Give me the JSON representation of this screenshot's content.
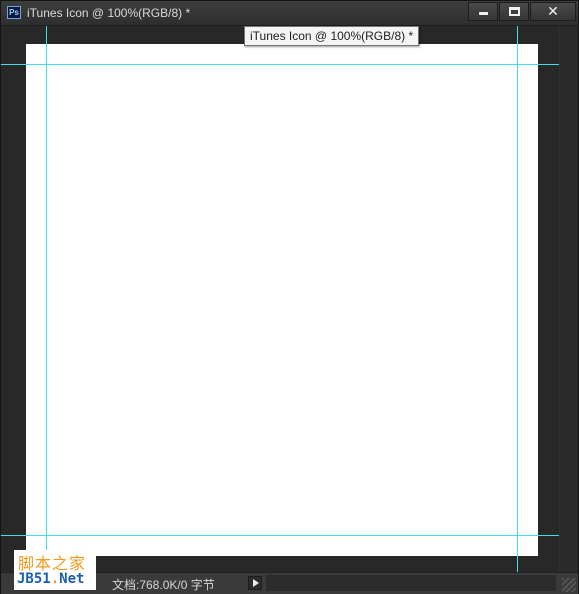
{
  "window": {
    "app_icon_label": "Ps",
    "title": "iTunes Icon @ 100%(RGB/8) *"
  },
  "tooltip": {
    "text": "iTunes Icon @ 100%(RGB/8) *"
  },
  "controls": {
    "minimize_icon": "minimize-icon",
    "maximize_icon": "maximize-icon",
    "close_icon": "close-icon",
    "close_glyph": "✕"
  },
  "status": {
    "doc_info": "文档:768.0K/0 字节"
  },
  "watermark": {
    "line1": "脚本之家",
    "line2_prefix": "JB51",
    "line2_dot": ".",
    "line2_suffix": "Net"
  },
  "colors": {
    "guide": "#3fe0e8",
    "canvas": "#ffffff",
    "workspace": "#282828"
  }
}
